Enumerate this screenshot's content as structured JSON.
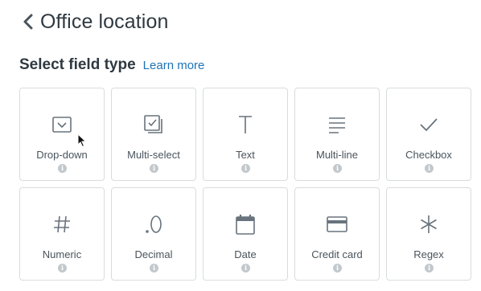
{
  "header": {
    "title": "Office location",
    "back_icon": "chevron-left-icon"
  },
  "section": {
    "title": "Select field type",
    "learn_more": "Learn more"
  },
  "colors": {
    "text": "#2f3941",
    "link": "#1f73b7",
    "border": "#d8dcde",
    "icon": "#68737d",
    "info": "#c2c8cc"
  },
  "field_types": [
    {
      "label": "Drop-down",
      "icon": "dropdown-icon"
    },
    {
      "label": "Multi-select",
      "icon": "multiselect-icon"
    },
    {
      "label": "Text",
      "icon": "text-icon"
    },
    {
      "label": "Multi-line",
      "icon": "multiline-icon"
    },
    {
      "label": "Checkbox",
      "icon": "checkmark-icon"
    },
    {
      "label": "Numeric",
      "icon": "hash-icon"
    },
    {
      "label": "Decimal",
      "icon": "decimal-icon"
    },
    {
      "label": "Date",
      "icon": "calendar-icon"
    },
    {
      "label": "Credit card",
      "icon": "credit-card-icon"
    },
    {
      "label": "Regex",
      "icon": "asterisk-icon"
    }
  ],
  "info_glyph": "i"
}
